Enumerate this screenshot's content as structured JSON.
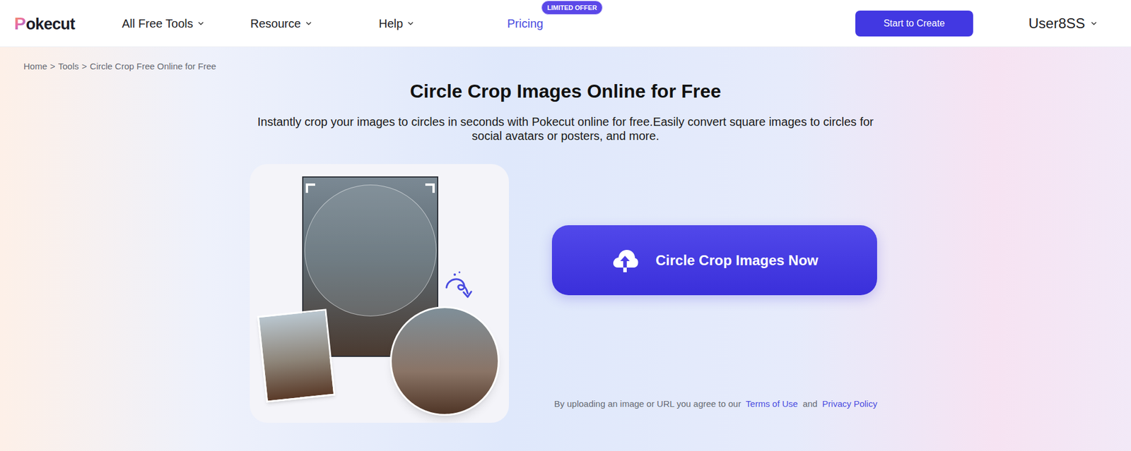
{
  "header": {
    "logo": {
      "mark": "P",
      "text": "okecut"
    },
    "nav": [
      {
        "label": "All Free Tools",
        "has_menu": true,
        "highlighted": false
      },
      {
        "label": "Resource",
        "has_menu": true,
        "highlighted": false
      },
      {
        "label": "Help",
        "has_menu": true,
        "highlighted": false
      },
      {
        "label": "Pricing",
        "has_menu": false,
        "highlighted": true,
        "badge": "LIMITED OFFER"
      }
    ],
    "cta": "Start to Create",
    "user": "User8SS"
  },
  "breadcrumb": [
    "Home",
    "Tools",
    "Circle Crop Free Online for Free"
  ],
  "breadcrumb_separator": ">",
  "title": "Circle Crop Images Online for Free",
  "subtitle": "Instantly crop your images to circles in seconds with Pokecut online for free.Easily convert square images to circles for social avatars or posters, and more.",
  "upload_button": "Circle Crop Images Now",
  "terms": {
    "prefix": "By uploading an image or URL you agree to our",
    "terms_link": "Terms of Use",
    "joiner": "and",
    "privacy_link": "Privacy Policy"
  }
}
